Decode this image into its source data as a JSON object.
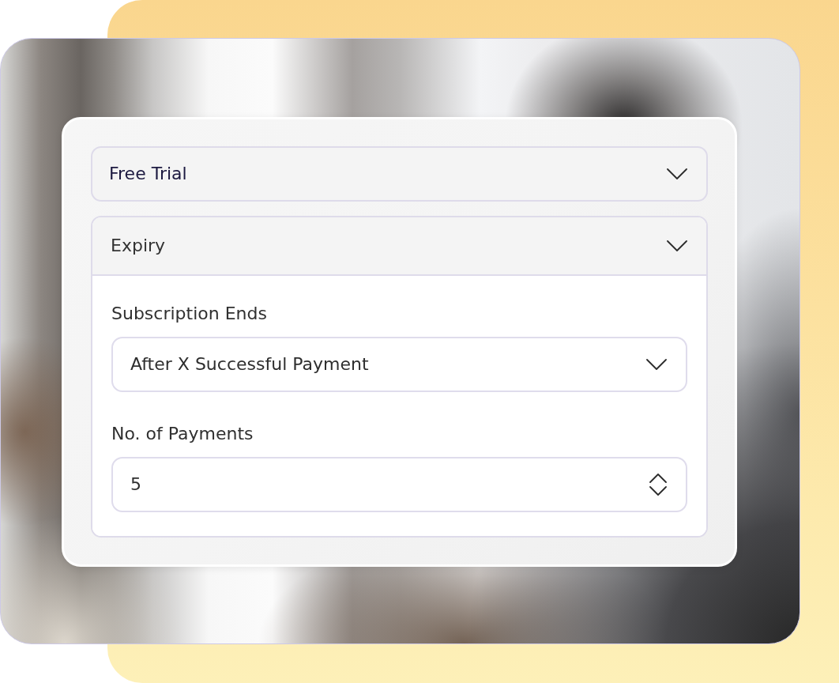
{
  "sections": [
    {
      "title": "Free Trial",
      "expanded": false
    },
    {
      "title": "Expiry",
      "expanded": true,
      "fields": [
        {
          "kind": "select",
          "label": "Subscription Ends",
          "value": "After X Successful Payment"
        },
        {
          "kind": "number",
          "label": "No. of Payments",
          "value": "5"
        }
      ]
    }
  ]
}
